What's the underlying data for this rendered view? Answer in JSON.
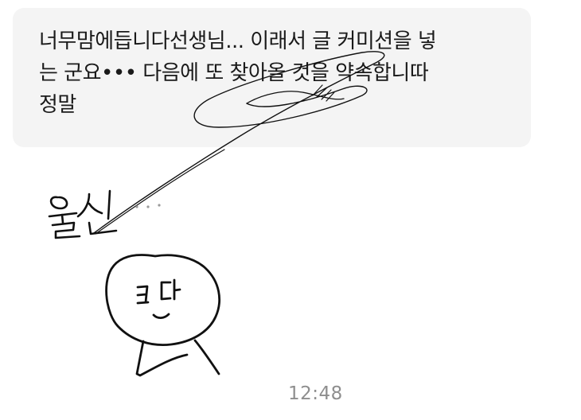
{
  "message": {
    "line1": "너무맘에듭니다선생님... 이래서 글 커미션을 넣",
    "line2": "는 군요••• 다음에 또 찾아올 것을 약속합니따",
    "line3": "정말"
  },
  "handwriting": {
    "word": "울신",
    "dots": "..."
  },
  "timestamp": "12:48"
}
